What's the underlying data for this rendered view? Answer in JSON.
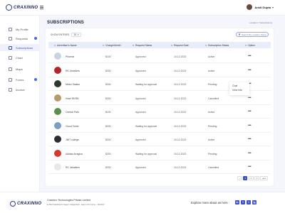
{
  "header": {
    "logo_text": "CRAXINNO",
    "logo_sub": "TECHNOLOGIES",
    "user_name": "Ankit Gupta"
  },
  "sidebar": {
    "items": [
      {
        "label": "My Profile"
      },
      {
        "label": "Requests"
      },
      {
        "label": "Subscriptions"
      },
      {
        "label": "Chart"
      },
      {
        "label": "Maps"
      },
      {
        "label": "Forms"
      },
      {
        "label": "Invoice"
      }
    ]
  },
  "page": {
    "title": "SUBSCRIPTIONS",
    "breadcrumb": "Location / Subscriptions"
  },
  "table": {
    "entries_label": "SHOW ENTRIES",
    "entries_value": "10",
    "search_placeholder": "Search By Location Name",
    "columns": [
      "Advertiser's Name",
      "Charge/Month",
      "Request Status",
      "Request Date",
      "Subscription Status",
      "Option"
    ],
    "rows": [
      {
        "name": "Phoenix",
        "charge": "$100",
        "status": "Approved",
        "date": "10-12-2022",
        "sub": "Active",
        "avatar_color": "#c9d3e6"
      },
      {
        "name": "RK Jewellers",
        "charge": "$200",
        "status": "Approved",
        "date": "10-12-2022",
        "sub": "Active",
        "avatar_color": "#b3262c"
      },
      {
        "name": "Metro Station",
        "charge": "$200",
        "status": "Waiting for approval",
        "date": "10-12-2022",
        "sub": "Pending",
        "avatar_color": "#2a3b2d"
      },
      {
        "name": "Hotel RKRN",
        "charge": "$200",
        "status": "Approved",
        "date": "10-12-2022",
        "sub": "Cancelled",
        "avatar_color": "#b89a6a"
      },
      {
        "name": "Central Park",
        "charge": "$100",
        "status": "Approved",
        "date": "10-12-2022",
        "sub": "Active",
        "avatar_color": "#5b8f4c"
      },
      {
        "name": "Cloud Tower",
        "charge": "$200",
        "status": "Waiting for approval",
        "date": "10-12-2022",
        "sub": "Pending",
        "avatar_color": "#7c9cc4"
      },
      {
        "name": "JNIT college",
        "charge": "$200",
        "status": "Approved",
        "date": "10-12-2022",
        "sub": "Active",
        "avatar_color": "#2c2c34"
      },
      {
        "name": "Adidas Arragica",
        "charge": "$200",
        "status": "Waiting for approval",
        "date": "10-12-2022",
        "sub": "Pending",
        "avatar_color": "#d23a34"
      },
      {
        "name": "RC Jewellers",
        "charge": "$200",
        "status": "Approved",
        "date": "10-12-2022",
        "sub": "Cancelled",
        "avatar_color": "#e8e8e8"
      }
    ]
  },
  "popup": {
    "items": [
      "Chat",
      "View Info"
    ]
  },
  "pagination": {
    "pages": [
      "1",
      "2",
      "3"
    ],
    "next": "next"
  },
  "footer": {
    "company": "Craxinno Technologies Private Limited",
    "address": "E-59A Siddharth Nagar, Rajasthan, Jaipur Province - 302017",
    "explore": "Explore more about us here :",
    "social": [
      "in",
      "f",
      "t",
      "ig"
    ]
  },
  "colors": {
    "accent": "#3f51c6",
    "header_row": "#e8edfb"
  }
}
